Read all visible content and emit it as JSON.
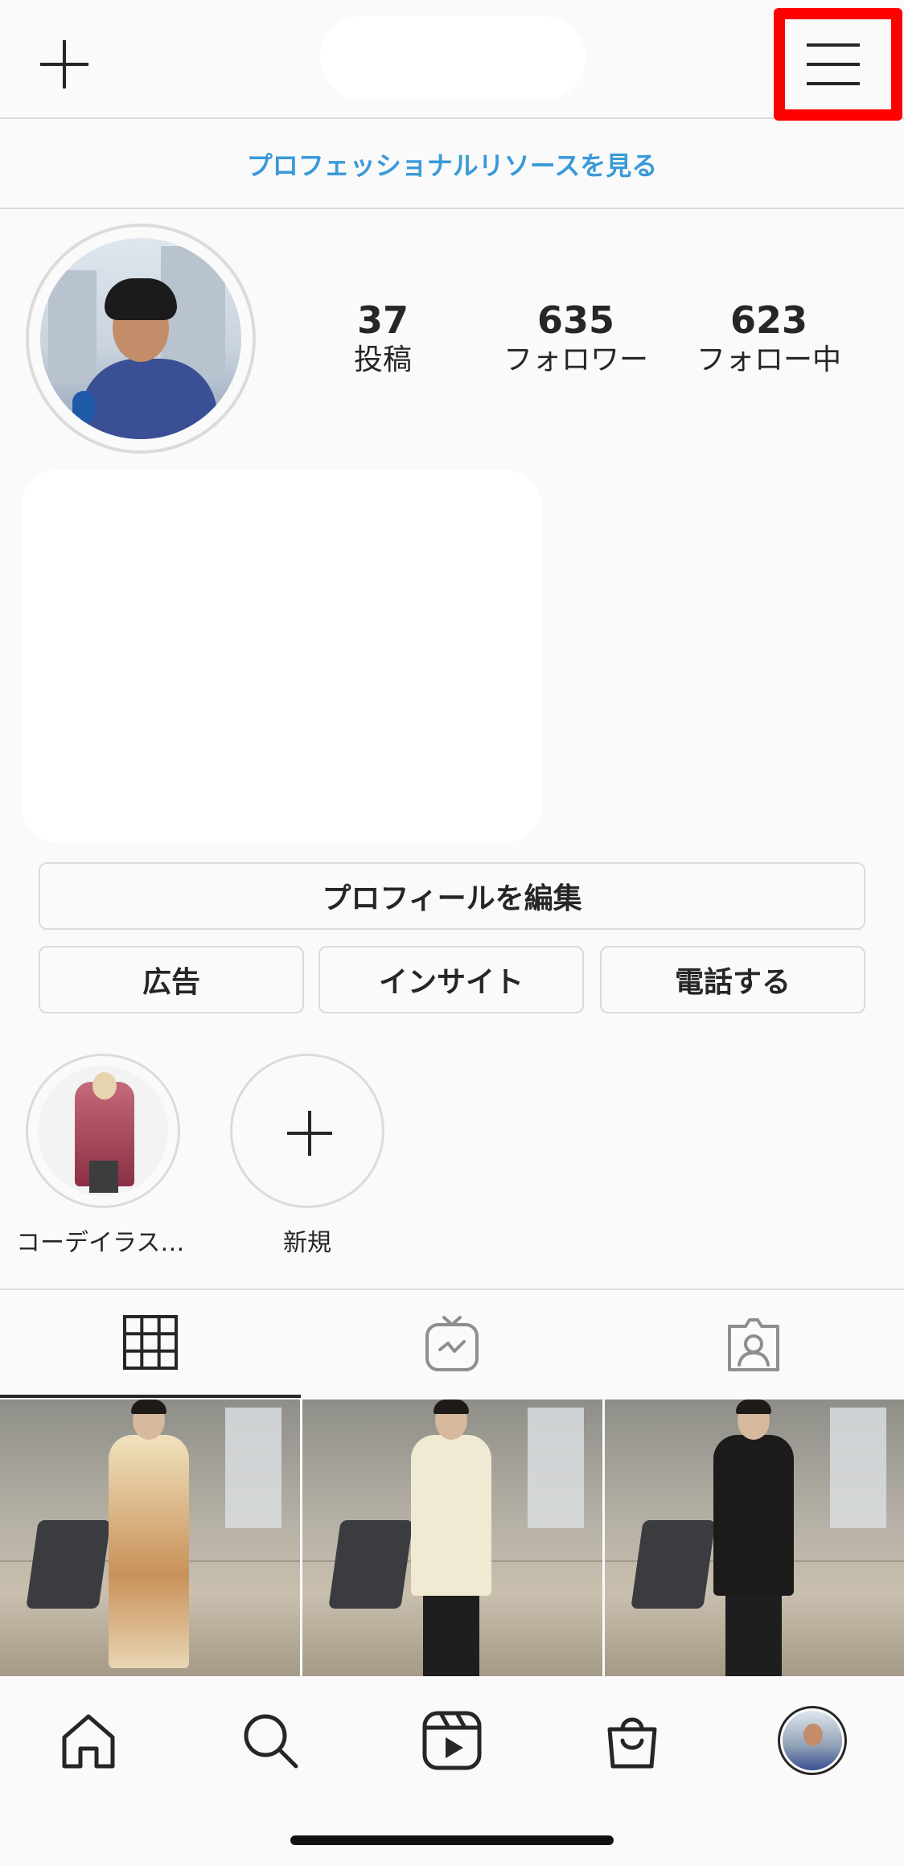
{
  "pro_banner": {
    "text": "プロフェッショナルリソースを見る"
  },
  "stats": {
    "posts": {
      "count": "37",
      "label": "投稿"
    },
    "followers": {
      "count": "635",
      "label": "フォロワー"
    },
    "following": {
      "count": "623",
      "label": "フォロー中"
    }
  },
  "buttons": {
    "edit_profile": "プロフィールを編集",
    "ads": "広告",
    "insights": "インサイト",
    "call": "電話する"
  },
  "highlights": [
    {
      "label": "コーデイラス…"
    },
    {
      "label": "新規"
    }
  ],
  "tabs": [
    {
      "icon": "grid-icon",
      "active": true
    },
    {
      "icon": "igtv-icon",
      "active": false
    },
    {
      "icon": "tagged-icon",
      "active": false
    }
  ],
  "bottom_nav": [
    "home-icon",
    "search-icon",
    "reels-icon",
    "shop-icon",
    "profile-avatar"
  ],
  "colors": {
    "link": "#3a9ad9",
    "highlight_box": "#ff0000",
    "text": "#262626",
    "border": "#dbdbdb"
  }
}
